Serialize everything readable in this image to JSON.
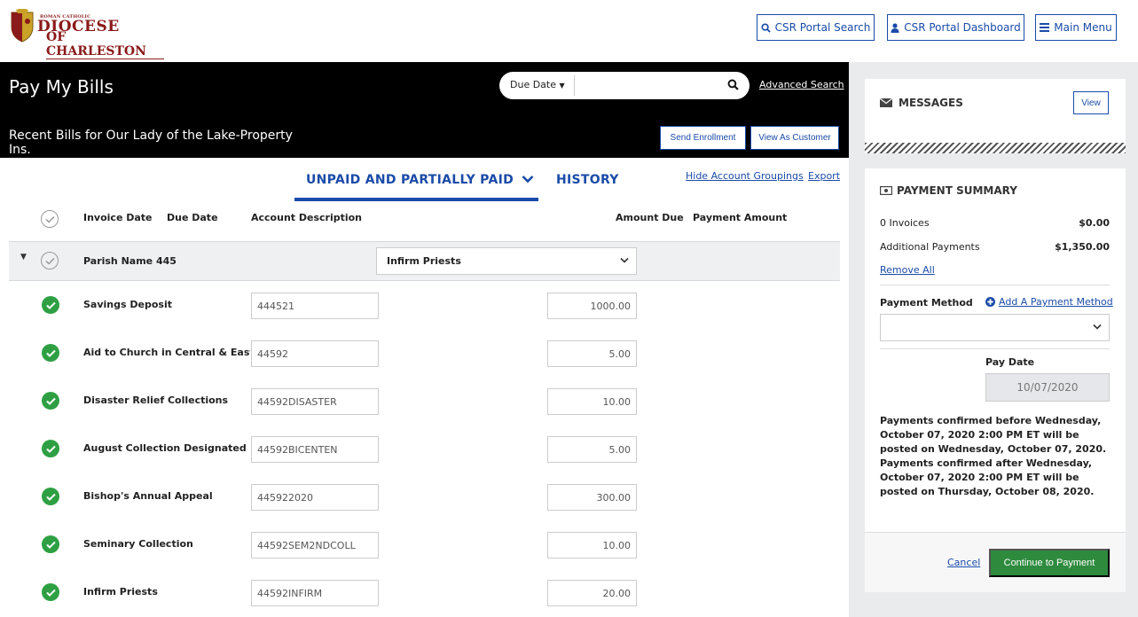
{
  "logo": {
    "line0": "ROMAN CATHOLIC",
    "line1": "DIOCESE",
    "line2": "OF CHARLESTON"
  },
  "topnav": {
    "csr_search": "CSR Portal Search",
    "csr_dashboard": "CSR Portal Dashboard",
    "main_menu": "Main Menu"
  },
  "header": {
    "title": "Pay My Bills",
    "search_filter": "Due Date",
    "advanced_search": "Advanced Search",
    "subtitle": "Recent Bills for Our Lady of the Lake-Property Ins.",
    "send_enrollment": "Send Enrollment",
    "view_as_customer": "View As Customer"
  },
  "tabs": {
    "unpaid": "UNPAID AND PARTIALLY PAID",
    "history": "HISTORY",
    "hide_groupings": "Hide Account Groupings",
    "export": "Export"
  },
  "table": {
    "headers": {
      "invoice_date": "Invoice Date",
      "due_date": "Due Date",
      "account_description": "Account Description",
      "amount_due": "Amount Due",
      "payment_amount": "Payment Amount"
    },
    "group": {
      "name": "Parish Name 445",
      "selected": "Infirm Priests"
    },
    "rows": [
      {
        "name": "Savings Deposit",
        "account": "444521",
        "amount": "1000.00"
      },
      {
        "name": "Aid to Church in Central & Eastern",
        "account": "44592",
        "amount": "5.00"
      },
      {
        "name": "Disaster Relief Collections",
        "account": "44592DISASTER",
        "amount": "10.00"
      },
      {
        "name": "August Collection Designated by Bi",
        "account": "44592BICENTEN",
        "amount": "5.00"
      },
      {
        "name": "Bishop's Annual Appeal",
        "account": "445922020",
        "amount": "300.00"
      },
      {
        "name": "Seminary Collection",
        "account": "44592SEM2NDCOLL",
        "amount": "10.00"
      },
      {
        "name": "Infirm Priests",
        "account": "44592INFIRM",
        "amount": "20.00"
      }
    ]
  },
  "messages": {
    "title": "MESSAGES",
    "view": "View"
  },
  "payment_summary": {
    "title": "PAYMENT SUMMARY",
    "invoices_label": "0 Invoices",
    "invoices_value": "$0.00",
    "additional_label": "Additional Payments",
    "additional_value": "$1,350.00",
    "remove_all": "Remove All",
    "payment_method_label": "Payment Method",
    "add_payment_method": "Add A Payment Method",
    "pay_date_label": "Pay Date",
    "pay_date": "10/07/2020",
    "notice": "Payments confirmed before Wednesday, October 07, 2020 2:00 PM ET will be posted on Wednesday, October 07, 2020. Payments confirmed after Wednesday, October 07, 2020 2:00 PM ET will be posted on Thursday, October 08, 2020.",
    "cancel": "Cancel",
    "continue": "Continue to Payment"
  },
  "colors": {
    "accent": "#1a4ba8",
    "success": "#2ea043",
    "brand": "#8b1a1a"
  }
}
